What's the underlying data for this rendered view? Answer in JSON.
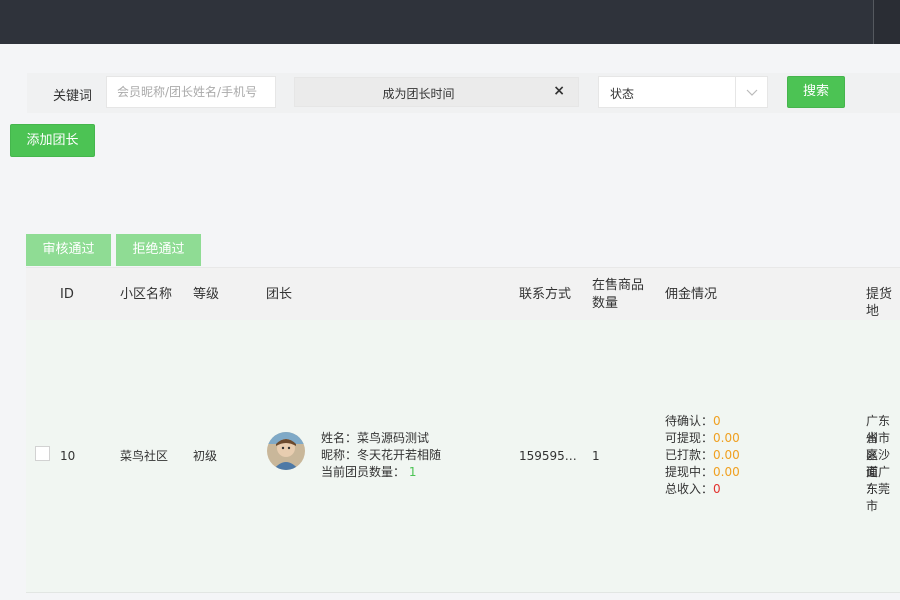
{
  "filters": {
    "keyword_label": "关键词",
    "keyword_placeholder": "会员昵称/团长姓名/手机号",
    "date_range_placeholder": "成为团长时间",
    "clear_icon": "×",
    "status_placeholder": "状态",
    "search_label": "搜索"
  },
  "actions": {
    "add_label": "添加团长",
    "approve_label": "审核通过",
    "reject_label": "拒绝通过"
  },
  "table": {
    "headers": {
      "id": "ID",
      "community": "小区名称",
      "level": "等级",
      "leader": "团长",
      "contact": "联系方式",
      "goods_line1": "在售商品",
      "goods_line2": "数量",
      "commission": "佣金情况",
      "pickup": "提货地"
    },
    "rows": [
      {
        "id": "10",
        "community": "菜鸟社区",
        "level": "初级",
        "name_label": "姓名：",
        "name": "菜鸟源码测试",
        "nick_label": "昵称：",
        "nick": "冬天花开若相随",
        "members_label": "当前团员数量：",
        "members": "1",
        "contact": "159595…",
        "goods_count": "1",
        "pending_label": "待确认：",
        "pending": "0",
        "withdrawable_label": "可提现：",
        "withdrawable": "0.00",
        "paid_label": "已打款：",
        "paid": "0.00",
        "withdrawing_label": "提现中：",
        "withdrawing": "0.00",
        "total_label": "总收入：",
        "total": "0",
        "address_lines": [
          "广东省",
          "州市嘉",
          "区沙面",
          "道广东",
          "东莞市"
        ]
      }
    ]
  },
  "colors": {
    "accent": "#4cc354",
    "topbar": "#2f333b",
    "orange": "#f0a020",
    "red": "#e2312d"
  },
  "icons": {
    "clear": "close-icon",
    "select": "chevron-down-icon",
    "avatar": "user-avatar"
  }
}
